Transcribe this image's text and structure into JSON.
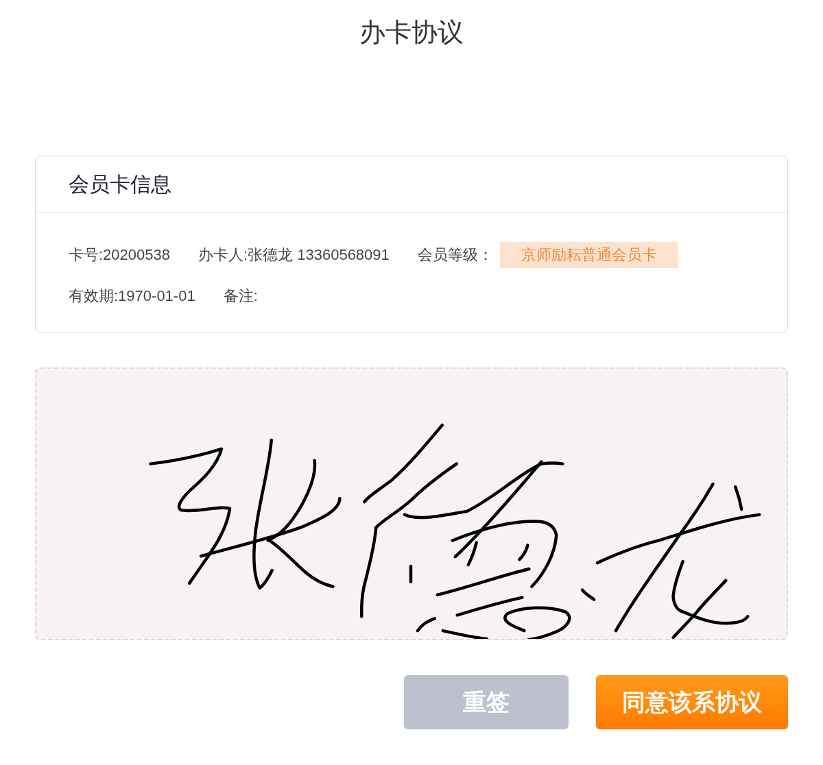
{
  "title": "办卡协议",
  "card": {
    "title": "会员卡信息",
    "rows": [
      [
        {
          "kind": "text",
          "text": "卡号:20200538"
        },
        {
          "kind": "text",
          "text": "办卡人:张德龙 13360568091"
        },
        {
          "kind": "tag",
          "label": "会员等级：",
          "value": "京师励耘普通会员卡"
        }
      ],
      [
        {
          "kind": "text",
          "text": "有效期:1970-01-01"
        },
        {
          "kind": "text",
          "text": "备注:"
        }
      ]
    ]
  },
  "buttons": [
    {
      "kind": "secondary",
      "label": "重签"
    },
    {
      "kind": "primary",
      "label": "同意该系协议"
    }
  ]
}
